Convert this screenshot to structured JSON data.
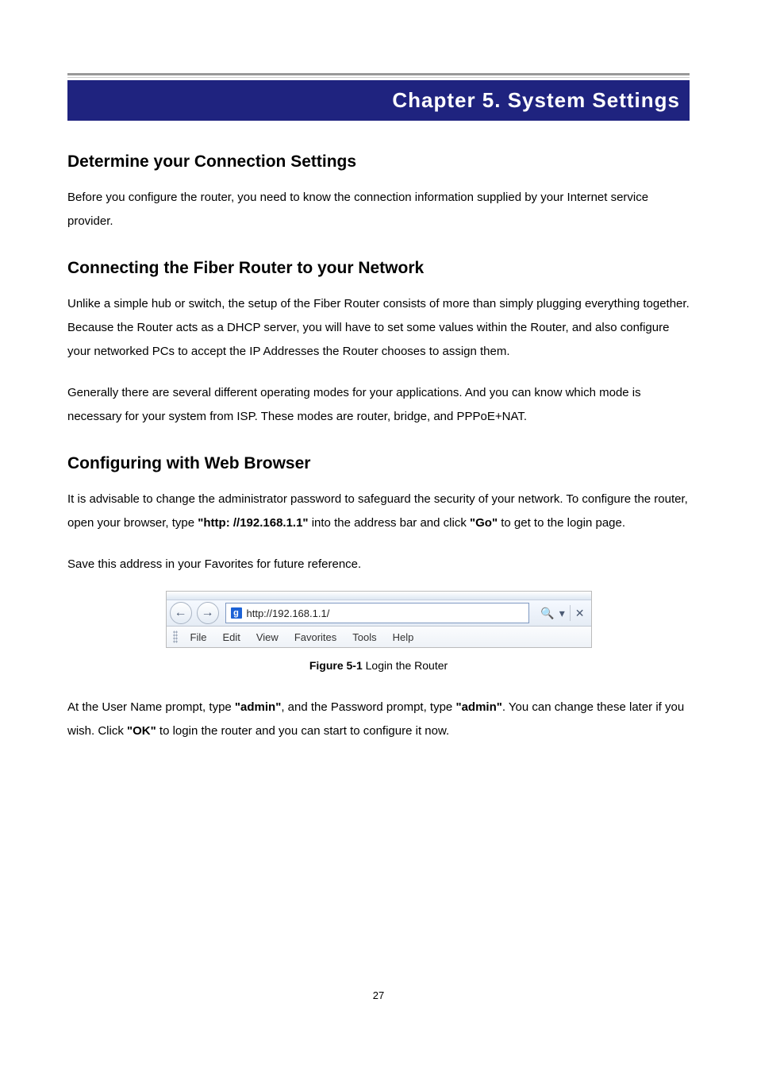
{
  "chapter_title": "Chapter  5.  System  Settings",
  "sections": {
    "s1": {
      "heading": "Determine your Connection Settings",
      "p1": "Before you configure the router, you need to know the connection information supplied by your Internet service provider."
    },
    "s2": {
      "heading": "Connecting the Fiber Router to your Network",
      "p1": "Unlike a simple hub or switch, the setup of the Fiber Router consists of more than simply plugging everything together. Because the Router acts as a DHCP server, you will have to set some values within the Router, and also configure your networked PCs to accept the IP Addresses the Router chooses to assign them.",
      "p2": "Generally there are several different operating modes for your applications. And you can know which mode is necessary for your system from ISP. These modes are router, bridge, and PPPoE+NAT."
    },
    "s3": {
      "heading": "Configuring with Web Browser",
      "p1_a": "It is advisable to change the administrator password to safeguard the security of your network. To configure the router, open your browser, type ",
      "p1_b": "\"http: //192.168.1.1\"",
      "p1_c": " into the address bar and click ",
      "p1_d": "\"Go\"",
      "p1_e": " to get to the login page.",
      "p2": "Save this address in your Favorites for future reference.",
      "p3_a": "At the User Name prompt, type ",
      "p3_b": "\"admin\"",
      "p3_c": ", and the Password prompt, type ",
      "p3_d": "\"admin\"",
      "p3_e": ". You can change these later if you wish. Click ",
      "p3_f": "\"OK\"",
      "p3_g": " to login the router and you can start to configure it now."
    }
  },
  "figure": {
    "address_url": "http://192.168.1.1/",
    "badge": "g",
    "menu": {
      "file": "File",
      "edit": "Edit",
      "view": "View",
      "favorites": "Favorites",
      "tools": "Tools",
      "help": "Help"
    },
    "caption_num": "Figure 5-1",
    "caption_text": " Login the Router",
    "glyphs": {
      "back": "←",
      "forward": "→",
      "search": "🔍",
      "dropdown": "▾",
      "close": "✕"
    }
  },
  "page_number": "27"
}
